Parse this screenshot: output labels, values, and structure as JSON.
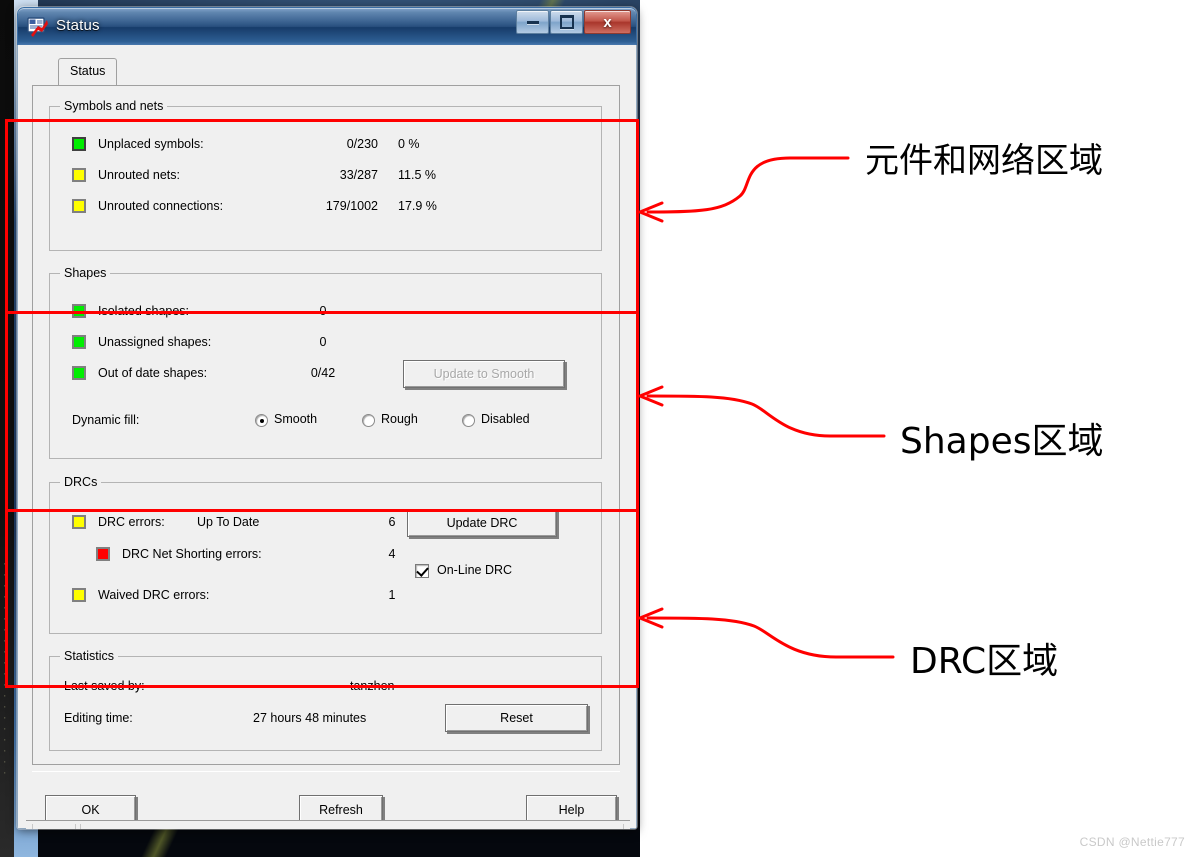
{
  "window": {
    "title": "Status",
    "icon": "allegro-pcb-icon",
    "controls": {
      "minimize": "–",
      "maximize": "□",
      "close": "x"
    }
  },
  "tabs": [
    {
      "label": "Status",
      "selected": true
    }
  ],
  "groups": {
    "symbols_and_nets": {
      "legend": "Symbols and nets",
      "rows": [
        {
          "swatch": "#00ee00",
          "swatch_style": "dark",
          "label": "Unplaced symbols:",
          "value": "0/230",
          "percent": "0 %"
        },
        {
          "swatch": "#ffff00",
          "swatch_style": "normal",
          "label": "Unrouted nets:",
          "value": "33/287",
          "percent": "11.5 %"
        },
        {
          "swatch": "#ffff00",
          "swatch_style": "normal",
          "label": "Unrouted connections:",
          "value": "179/1002",
          "percent": "17.9 %"
        }
      ]
    },
    "shapes": {
      "legend": "Shapes",
      "rows": [
        {
          "swatch": "#00ee00",
          "swatch_style": "normal",
          "label": "Isolated shapes:",
          "value": "0",
          "percent": ""
        },
        {
          "swatch": "#00ee00",
          "swatch_style": "normal",
          "label": "Unassigned shapes:",
          "value": "0",
          "percent": ""
        },
        {
          "swatch": "#00ee00",
          "swatch_style": "normal",
          "label": "Out of date shapes:",
          "value": "0/42",
          "percent": ""
        }
      ],
      "update_button": {
        "label": "Update to Smooth",
        "disabled": true
      },
      "dynamic_fill_label": "Dynamic fill:",
      "dynamic_fill_options": [
        {
          "label": "Smooth",
          "selected": true
        },
        {
          "label": "Rough",
          "selected": false
        },
        {
          "label": "Disabled",
          "selected": false
        }
      ]
    },
    "drcs": {
      "legend": "DRCs",
      "rows": [
        {
          "swatch": "#ffff00",
          "swatch_style": "normal",
          "label": "DRC errors:",
          "status": "Up To Date",
          "value": "6"
        },
        {
          "swatch": "#ff0000",
          "swatch_style": "normal",
          "label": "DRC Net Shorting errors:",
          "status": "",
          "value": "4"
        },
        {
          "swatch": "#ffff00",
          "swatch_style": "normal",
          "label": "Waived DRC errors:",
          "status": "",
          "value": "1"
        }
      ],
      "update_drc_button": "Update DRC",
      "online_drc": {
        "label": "On-Line DRC",
        "checked": true
      }
    },
    "statistics": {
      "legend": "Statistics",
      "last_saved_by_label": "Last saved by:",
      "last_saved_by_value": "tanzhen",
      "editing_time_label": "Editing time:",
      "editing_time_value": "27 hours 48 minutes",
      "reset_button": "Reset"
    }
  },
  "footer_buttons": {
    "ok": "OK",
    "refresh": "Refresh",
    "help": "Help"
  },
  "annotations": {
    "color": "#ff0000",
    "labels": [
      {
        "text": "元件和网络区域",
        "size": 34
      },
      {
        "text": "Shapes区域",
        "size": 34
      },
      {
        "text": "DRC区域",
        "size": 34
      }
    ]
  },
  "watermark": "CSDN @Nettie777"
}
